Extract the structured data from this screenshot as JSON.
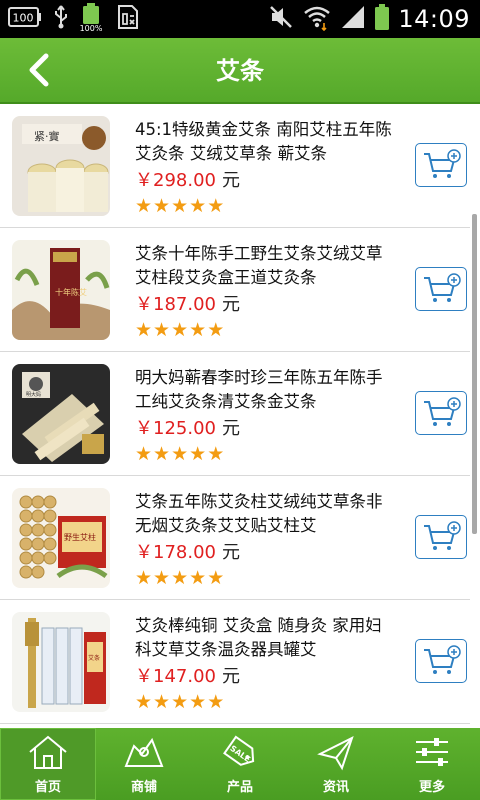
{
  "status_bar": {
    "battery_left_label": "100",
    "battery_percent": "100%",
    "time": "14:09"
  },
  "header": {
    "title": "艾条"
  },
  "products": [
    {
      "name": "45:1特级黄金艾条 南阳艾柱五年陈艾灸条 艾绒艾草条 蕲艾条",
      "price": "￥298.00",
      "unit": "元",
      "rating": 5,
      "thumb_label": "紧·實"
    },
    {
      "name": "艾条十年陈手工野生艾条艾绒艾草艾柱段艾灸盒王道艾灸条",
      "price": "￥187.00",
      "unit": "元",
      "rating": 5,
      "thumb_label": "十年陈艾"
    },
    {
      "name": "明大妈蕲春李时珍三年陈五年陈手工纯艾灸条清艾条金艾条",
      "price": "￥125.00",
      "unit": "元",
      "rating": 5,
      "thumb_label": "明大妈"
    },
    {
      "name": "艾条五年陈艾灸柱艾绒纯艾草条非无烟艾灸条艾艾贴艾柱艾",
      "price": "￥178.00",
      "unit": "元",
      "rating": 5,
      "thumb_label": "野生艾柱"
    },
    {
      "name": "艾灸棒纯铜 艾灸盒 随身灸 家用妇科艾草艾条温灸器具罐艾",
      "price": "￥147.00",
      "unit": "元",
      "rating": 5,
      "thumb_label": "艾条"
    }
  ],
  "nav": {
    "home": "首页",
    "shop": "商铺",
    "products": "产品",
    "news": "资讯",
    "more": "更多",
    "sale_tag": "SALE"
  },
  "colors": {
    "header_green": "#5fb22e",
    "price_red": "#e02020",
    "star_orange": "#f39c12",
    "cart_blue": "#2e7fc1"
  }
}
